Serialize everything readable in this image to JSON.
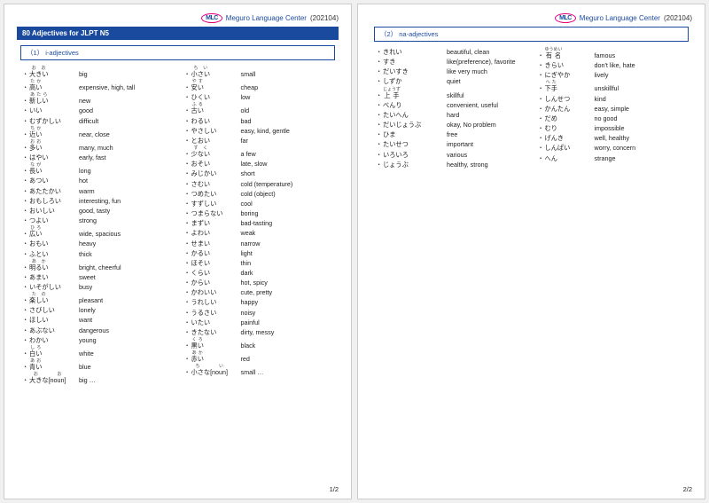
{
  "brand": {
    "logo": "MLC",
    "org": "Meguro Language Center",
    "date": "(202104)"
  },
  "page1": {
    "title": "80 Adjectives for JLPT N5",
    "section": "（1） i-adjectives",
    "left": [
      {
        "jp": "大きい",
        "en": "big",
        "ruby": "おお"
      },
      {
        "jp": "高い",
        "en": "expensive, high, tall",
        "ruby": "たか"
      },
      {
        "jp": "",
        "en": ""
      },
      {
        "jp": "新しい",
        "en": "new",
        "ruby": "あたら"
      },
      {
        "jp": "いい",
        "en": "good"
      },
      {
        "jp": "むずかしい",
        "en": "difficult"
      },
      {
        "jp": "近い",
        "en": "near, close",
        "ruby": "ちか"
      },
      {
        "jp": "多い",
        "en": "many, much",
        "ruby": "おお"
      },
      {
        "jp": "はやい",
        "en": "early, fast"
      },
      {
        "jp": "長い",
        "en": "long",
        "ruby": "なが"
      },
      {
        "jp": "あつい",
        "en": "hot"
      },
      {
        "jp": "",
        "en": ""
      },
      {
        "jp": "あたたかい",
        "en": "warm"
      },
      {
        "jp": "おもしろい",
        "en": "interesting, fun"
      },
      {
        "jp": "おいしい",
        "en": "good, tasty"
      },
      {
        "jp": "つよい",
        "en": "strong"
      },
      {
        "jp": "広い",
        "en": "wide, spacious",
        "ruby": "ひろ"
      },
      {
        "jp": "おもい",
        "en": "heavy"
      },
      {
        "jp": "ふとい",
        "en": "thick"
      },
      {
        "jp": "明るい",
        "en": "bright, cheerful",
        "ruby": "あか"
      },
      {
        "jp": "あまい",
        "en": "sweet"
      },
      {
        "jp": "いそがしい",
        "en": "busy"
      },
      {
        "jp": "楽しい",
        "en": "pleasant",
        "ruby": "たの"
      },
      {
        "jp": "さびしい",
        "en": "lonely"
      },
      {
        "jp": "ほしい",
        "en": "want"
      },
      {
        "jp": "あぶない",
        "en": "dangerous"
      },
      {
        "jp": "わかい",
        "en": "young"
      },
      {
        "jp": "白い",
        "en": "white",
        "ruby": "しろ"
      },
      {
        "jp": "青い",
        "en": "blue",
        "ruby": "あお"
      },
      {
        "jp": "大きな[noun]",
        "en": "big …",
        "ruby": "おお"
      }
    ],
    "right": [
      {
        "jp": "小さい",
        "en": "small",
        "ruby": "ちい"
      },
      {
        "jp": "安い",
        "en": "cheap",
        "ruby": "やす"
      },
      {
        "jp": "ひくい",
        "en": "low"
      },
      {
        "jp": "古い",
        "en": "old",
        "ruby": "ふる"
      },
      {
        "jp": "わるい",
        "en": "bad"
      },
      {
        "jp": "やさしい",
        "en": "easy, kind, gentle"
      },
      {
        "jp": "とおい",
        "en": "far"
      },
      {
        "jp": "少ない",
        "en": "a few",
        "ruby": "すく"
      },
      {
        "jp": "おそい",
        "en": "late, slow"
      },
      {
        "jp": "みじかい",
        "en": "short"
      },
      {
        "jp": "さむい",
        "en": "cold (temperature)"
      },
      {
        "jp": "つめたい",
        "en": "cold (object)"
      },
      {
        "jp": "すずしい",
        "en": "cool"
      },
      {
        "jp": "つまらない",
        "en": "boring"
      },
      {
        "jp": "まずい",
        "en": "bad-tasting"
      },
      {
        "jp": "よわい",
        "en": "weak"
      },
      {
        "jp": "せまい",
        "en": "narrow"
      },
      {
        "jp": "かるい",
        "en": "light"
      },
      {
        "jp": "ほそい",
        "en": "thin"
      },
      {
        "jp": "くらい",
        "en": "dark"
      },
      {
        "jp": "からい",
        "en": "hot, spicy"
      },
      {
        "jp": "かわいい",
        "en": "cute, pretty"
      },
      {
        "jp": "うれしい",
        "en": "happy"
      },
      {
        "jp": "うるさい",
        "en": "noisy"
      },
      {
        "jp": "いたい",
        "en": "painful"
      },
      {
        "jp": "きたない",
        "en": "dirty, messy"
      },
      {
        "jp": "",
        "en": ""
      },
      {
        "jp": "黒い",
        "en": "black",
        "ruby": "くろ"
      },
      {
        "jp": "赤い",
        "en": "red",
        "ruby": "あか"
      },
      {
        "jp": "小さな[noun]",
        "en": "small …",
        "ruby": "ちい"
      }
    ],
    "pagenum": "1/2"
  },
  "page2": {
    "section": "（2） na-adjectives",
    "left": [
      {
        "jp": "きれい",
        "en": "beautiful, clean"
      },
      {
        "jp": "すき",
        "en": "like(preference), favorite"
      },
      {
        "jp": "だいすき",
        "en": "like very much"
      },
      {
        "jp": "しずか",
        "en": "quiet"
      },
      {
        "jp": "上手",
        "en": "skillful",
        "ruby": "じょうず"
      },
      {
        "jp": "べんり",
        "en": "convenient, useful"
      },
      {
        "jp": "たいへん",
        "en": "hard"
      },
      {
        "jp": "だいじょうぶ",
        "en": "okay, No problem"
      },
      {
        "jp": "",
        "en": ""
      },
      {
        "jp": "ひま",
        "en": "free"
      },
      {
        "jp": "たいせつ",
        "en": "important"
      },
      {
        "jp": "いろいろ",
        "en": "various"
      },
      {
        "jp": "じょうぶ",
        "en": "healthy, strong"
      }
    ],
    "right": [
      {
        "jp": "有名",
        "en": "famous",
        "ruby": "ゆうめい"
      },
      {
        "jp": "きらい",
        "en": "don't like, hate"
      },
      {
        "jp": "",
        "en": ""
      },
      {
        "jp": "にぎやか",
        "en": "lively"
      },
      {
        "jp": "下手",
        "en": "unskillful",
        "ruby": "へた"
      },
      {
        "jp": "しんせつ",
        "en": "kind"
      },
      {
        "jp": "かんたん",
        "en": "easy, simple"
      },
      {
        "jp": "だめ",
        "en": "no good"
      },
      {
        "jp": "むり",
        "en": "impossible"
      },
      {
        "jp": "げんき",
        "en": "well, healthy"
      },
      {
        "jp": "しんぱい",
        "en": "worry, concern"
      },
      {
        "jp": "へん",
        "en": "strange"
      }
    ],
    "pagenum": "2/2"
  }
}
